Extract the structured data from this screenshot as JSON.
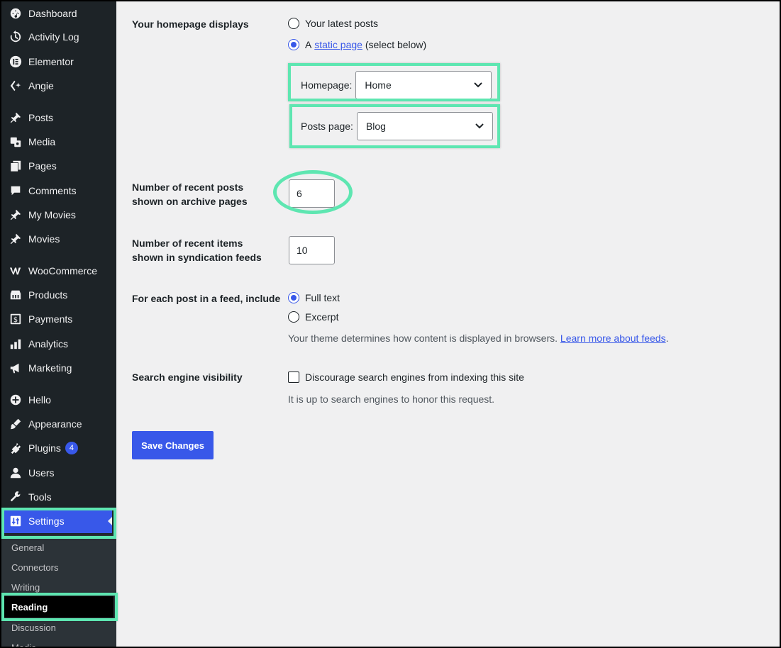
{
  "sidebar": {
    "items": [
      {
        "label": "Dashboard",
        "icon": "dashboard-icon"
      },
      {
        "label": "Activity Log",
        "icon": "history-icon"
      },
      {
        "label": "Elementor",
        "icon": "elementor-icon"
      },
      {
        "label": "Angie",
        "icon": "sparkle-icon"
      },
      {
        "label": "Posts",
        "icon": "pin-icon"
      },
      {
        "label": "Media",
        "icon": "media-icon"
      },
      {
        "label": "Pages",
        "icon": "pages-icon"
      },
      {
        "label": "Comments",
        "icon": "comment-icon"
      },
      {
        "label": "My Movies",
        "icon": "pin-icon"
      },
      {
        "label": "Movies",
        "icon": "pin-icon"
      },
      {
        "label": "WooCommerce",
        "icon": "woocommerce-icon"
      },
      {
        "label": "Products",
        "icon": "archive-icon"
      },
      {
        "label": "Payments",
        "icon": "money-icon"
      },
      {
        "label": "Analytics",
        "icon": "chart-bar-icon"
      },
      {
        "label": "Marketing",
        "icon": "megaphone-icon"
      },
      {
        "label": "Hello",
        "icon": "plus-circle-icon"
      },
      {
        "label": "Appearance",
        "icon": "brush-icon"
      },
      {
        "label": "Plugins",
        "icon": "plugin-icon",
        "badge": "4"
      },
      {
        "label": "Users",
        "icon": "user-icon"
      },
      {
        "label": "Tools",
        "icon": "wrench-icon"
      },
      {
        "label": "Settings",
        "icon": "settings-icon"
      }
    ],
    "submenu": [
      "General",
      "Connectors",
      "Writing",
      "Reading",
      "Discussion",
      "Media"
    ],
    "accent": "#3858e9",
    "highlight": "#5ee6b1"
  },
  "form": {
    "homepage_label": "Your homepage displays",
    "latest_posts": "Your latest posts",
    "static_prefix": "A",
    "static_link": "static page",
    "static_suffix": "(select below)",
    "homepage_select_label": "Homepage:",
    "homepage_value": "Home",
    "posts_page_label": "Posts page:",
    "posts_page_value": "Blog",
    "archive_label": "Number of recent posts shown on archive pages",
    "archive_value": "6",
    "syndication_label": "Number of recent items shown in syndication feeds",
    "syndication_value": "10",
    "feed_label": "For each post in a feed, include",
    "full_text": "Full text",
    "excerpt": "Excerpt",
    "feed_desc": "Your theme determines how content is displayed in browsers.",
    "feed_link": "Learn more about feeds",
    "feed_desc_end": ".",
    "search_label": "Search engine visibility",
    "discourage": "Discourage search engines from indexing this site",
    "search_desc": "It is up to search engines to honor this request.",
    "save": "Save Changes"
  }
}
